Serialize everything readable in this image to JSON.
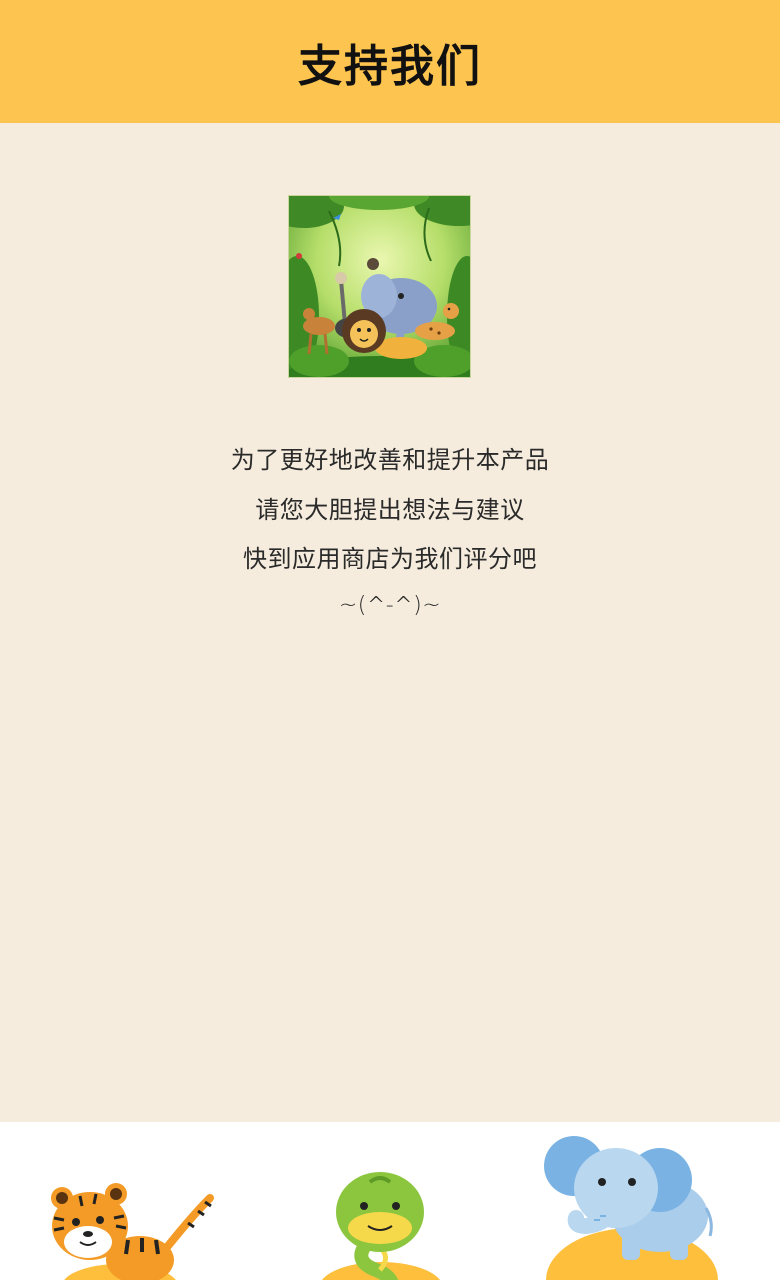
{
  "header": {
    "title": "支持我们"
  },
  "content": {
    "lines": [
      "为了更好地改善和提升本产品",
      "请您大胆提出想法与建议",
      "快到应用商店为我们评分吧",
      "~(^-^)~"
    ]
  },
  "colors": {
    "header_bg": "#fdc54f",
    "page_bg": "#f5ecdd",
    "footer_bg": "#ffffff",
    "mound": "#fdbf3c"
  },
  "illustrations": {
    "app_image": "jungle-animals-illustration",
    "footer": [
      "tiger-illustration",
      "snake-illustration",
      "elephant-illustration"
    ]
  }
}
